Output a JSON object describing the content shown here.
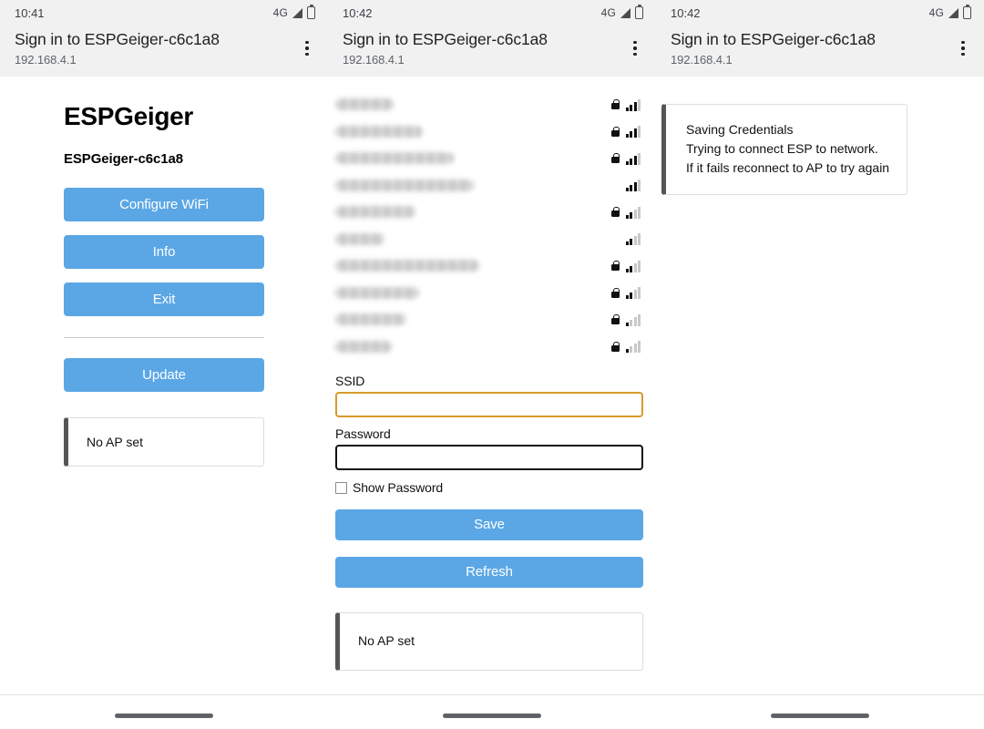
{
  "panels": [
    {
      "statusbar": {
        "time": "10:41",
        "network": "4G"
      },
      "header": {
        "title": "Sign in to ESPGeiger-c6c1a8",
        "url": "192.168.4.1"
      }
    },
    {
      "statusbar": {
        "time": "10:42",
        "network": "4G"
      },
      "header": {
        "title": "Sign in to ESPGeiger-c6c1a8",
        "url": "192.168.4.1"
      }
    },
    {
      "statusbar": {
        "time": "10:42",
        "network": "4G"
      },
      "header": {
        "title": "Sign in to ESPGeiger-c6c1a8",
        "url": "192.168.4.1"
      }
    }
  ],
  "left": {
    "app_title": "ESPGeiger",
    "device_name": "ESPGeiger-c6c1a8",
    "buttons": [
      {
        "label": "Configure WiFi"
      },
      {
        "label": "Info"
      },
      {
        "label": "Exit"
      }
    ],
    "update_button": {
      "label": "Update"
    },
    "status_note": "No AP set"
  },
  "middle": {
    "networks": [
      {
        "ssid": "",
        "width": 64,
        "secured": true,
        "signal": 3
      },
      {
        "ssid": "",
        "width": 96,
        "secured": true,
        "signal": 3
      },
      {
        "ssid": "",
        "width": 130,
        "secured": true,
        "signal": 3
      },
      {
        "ssid": "",
        "width": 152,
        "secured": false,
        "signal": 3
      },
      {
        "ssid": "",
        "width": 88,
        "secured": true,
        "signal": 2
      },
      {
        "ssid": "",
        "width": 54,
        "secured": false,
        "signal": 2
      },
      {
        "ssid": "",
        "width": 158,
        "secured": true,
        "signal": 2
      },
      {
        "ssid": "",
        "width": 92,
        "secured": true,
        "signal": 2
      },
      {
        "ssid": "",
        "width": 78,
        "secured": true,
        "signal": 1
      },
      {
        "ssid": "",
        "width": 62,
        "secured": true,
        "signal": 1
      }
    ],
    "signal_bar_count": 4,
    "form": {
      "ssid_label": "SSID",
      "ssid_value": "",
      "password_label": "Password",
      "password_value": "",
      "show_password_label": "Show Password",
      "show_password_checked": false,
      "save_label": "Save",
      "refresh_label": "Refresh"
    },
    "status_note": "No AP set"
  },
  "right": {
    "message_lines": [
      "Saving Credentials",
      "Trying to connect ESP to network.",
      "If it fails reconnect to AP to try again"
    ]
  },
  "colors": {
    "button_blue": "#5ba7e5",
    "header_bg": "#f1f1f2",
    "focus_orange": "#d99a28",
    "accent_bar": "#555555"
  }
}
